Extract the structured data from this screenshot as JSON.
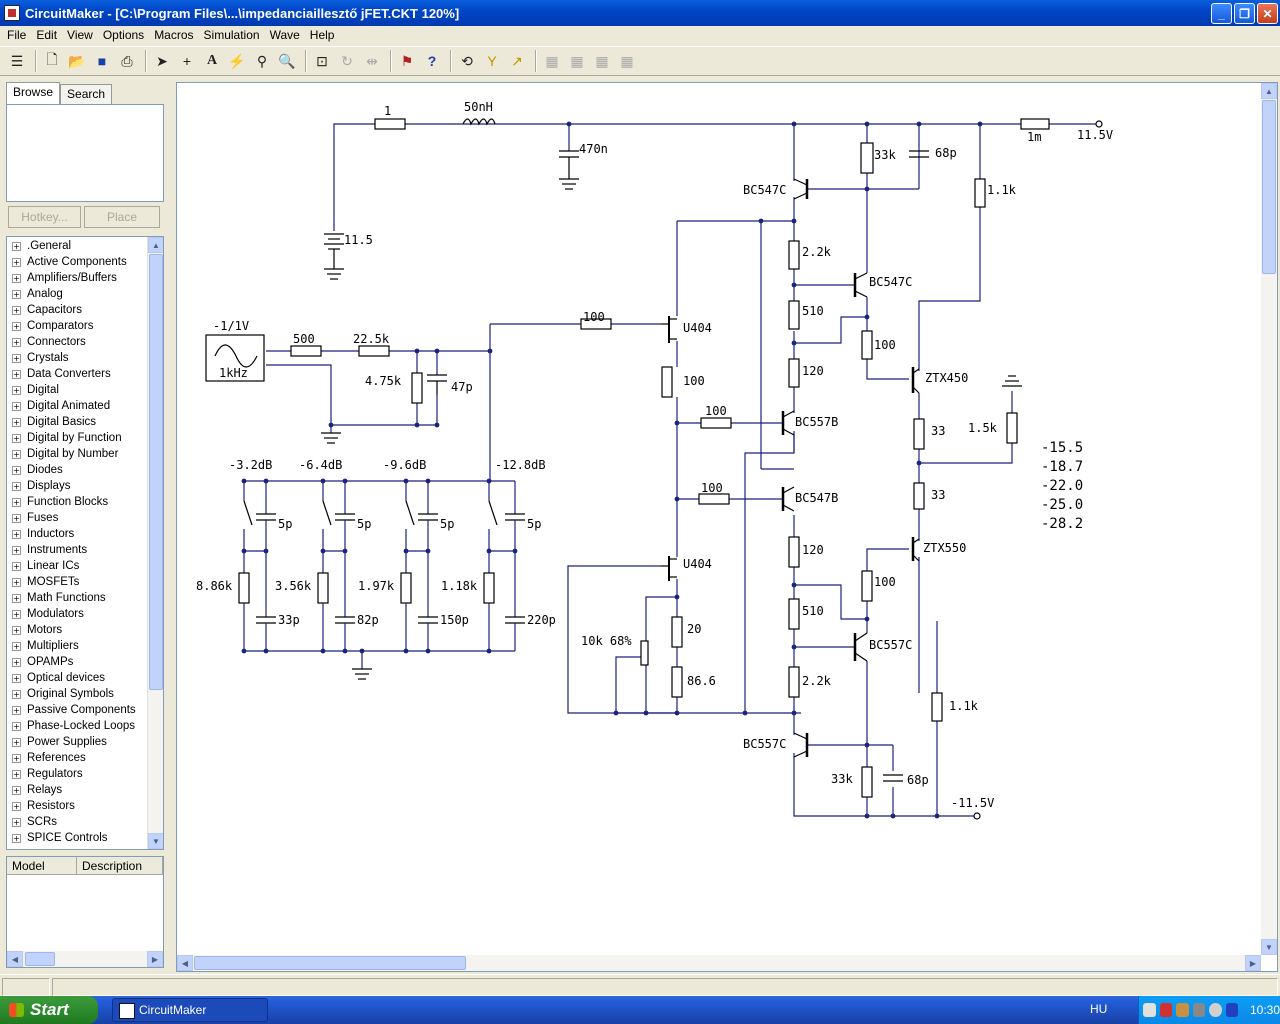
{
  "window": {
    "title": "CircuitMaker - [C:\\Program Files\\...\\impedanciaillesztő jFET.CKT 120%]"
  },
  "menu": [
    "File",
    "Edit",
    "View",
    "Options",
    "Macros",
    "Simulation",
    "Wave",
    "Help"
  ],
  "panel": {
    "tabs": [
      "Browse",
      "Search"
    ],
    "hotkey_label": "Hotkey...",
    "place_label": "Place",
    "tree": [
      ".General",
      "Active Components",
      "Amplifiers/Buffers",
      "Analog",
      "Capacitors",
      "Comparators",
      "Connectors",
      "Crystals",
      "Data Converters",
      "Digital",
      "Digital Animated",
      "Digital Basics",
      "Digital by Function",
      "Digital by Number",
      "Diodes",
      "Displays",
      "Function Blocks",
      "Fuses",
      "Inductors",
      "Instruments",
      "Linear ICs",
      "MOSFETs",
      "Math Functions",
      "Modulators",
      "Motors",
      "Multipliers",
      "OPAMPs",
      "Optical devices",
      "Original Symbols",
      "Passive Components",
      "Phase-Locked Loops",
      "Power Supplies",
      "References",
      "Regulators",
      "Relays",
      "Resistors",
      "SCRs",
      "SPICE Controls"
    ],
    "model_headers": [
      "Model",
      "Description"
    ]
  },
  "schematic": {
    "input_labels": {
      "r1": "1",
      "l1": "50nH",
      "c470": "470n",
      "batt": "11.5",
      "src_amp": "-1/1V",
      "src_freq": "1kHz",
      "r500": "500",
      "r22k": "22.5k",
      "r475": "4.75k",
      "c47": "47p",
      "r100in": "100",
      "rmeg": "1m",
      "vplus": "11.5V",
      "vminus": "-11.5V"
    },
    "attn": [
      "-3.2dB",
      "-6.4dB",
      "-9.6dB",
      "-12.8dB"
    ],
    "attn_caps_top": [
      "5p",
      "5p",
      "5p",
      "5p"
    ],
    "attn_res": [
      "8.86k",
      "3.56k",
      "1.97k",
      "1.18k"
    ],
    "attn_caps_bot": [
      "33p",
      "82p",
      "150p",
      "220p"
    ],
    "fets": [
      "U404",
      "U404"
    ],
    "transistors": {
      "q1": "BC547C",
      "q2": "BC547C",
      "q3": "BC557B",
      "q4": "BC547B",
      "q5": "BC557C",
      "q6": "BC557C",
      "q7": "ZTX450",
      "q8": "ZTX550"
    },
    "res_labels": {
      "r33k_top": "33k",
      "c68_top": "68p",
      "r11k_top": "1.1k",
      "r22k_top": "2.2k",
      "r510_top": "510",
      "r120_top": "120",
      "r100_b": "100",
      "r100_fet": "100",
      "r100_q3": "100",
      "r100_q4": "100",
      "r33_a": "33",
      "r33_b": "33",
      "r15k": "1.5k",
      "r120_bot": "120",
      "r510_bot": "510",
      "r22k_bot": "2.2k",
      "r100_bot": "100",
      "r20": "20",
      "r866": "86.6",
      "pot": "10k 68%",
      "r33k_bot": "33k",
      "c68_bot": "68p",
      "r11k_bot": "1.1k"
    },
    "readouts": [
      "-15.5",
      "-18.7",
      "-22.0",
      "-25.0",
      "-28.2"
    ]
  },
  "taskbar": {
    "start_label": "Start",
    "task_label": "CircuitMaker",
    "lang": "HU",
    "clock": "10:30"
  }
}
